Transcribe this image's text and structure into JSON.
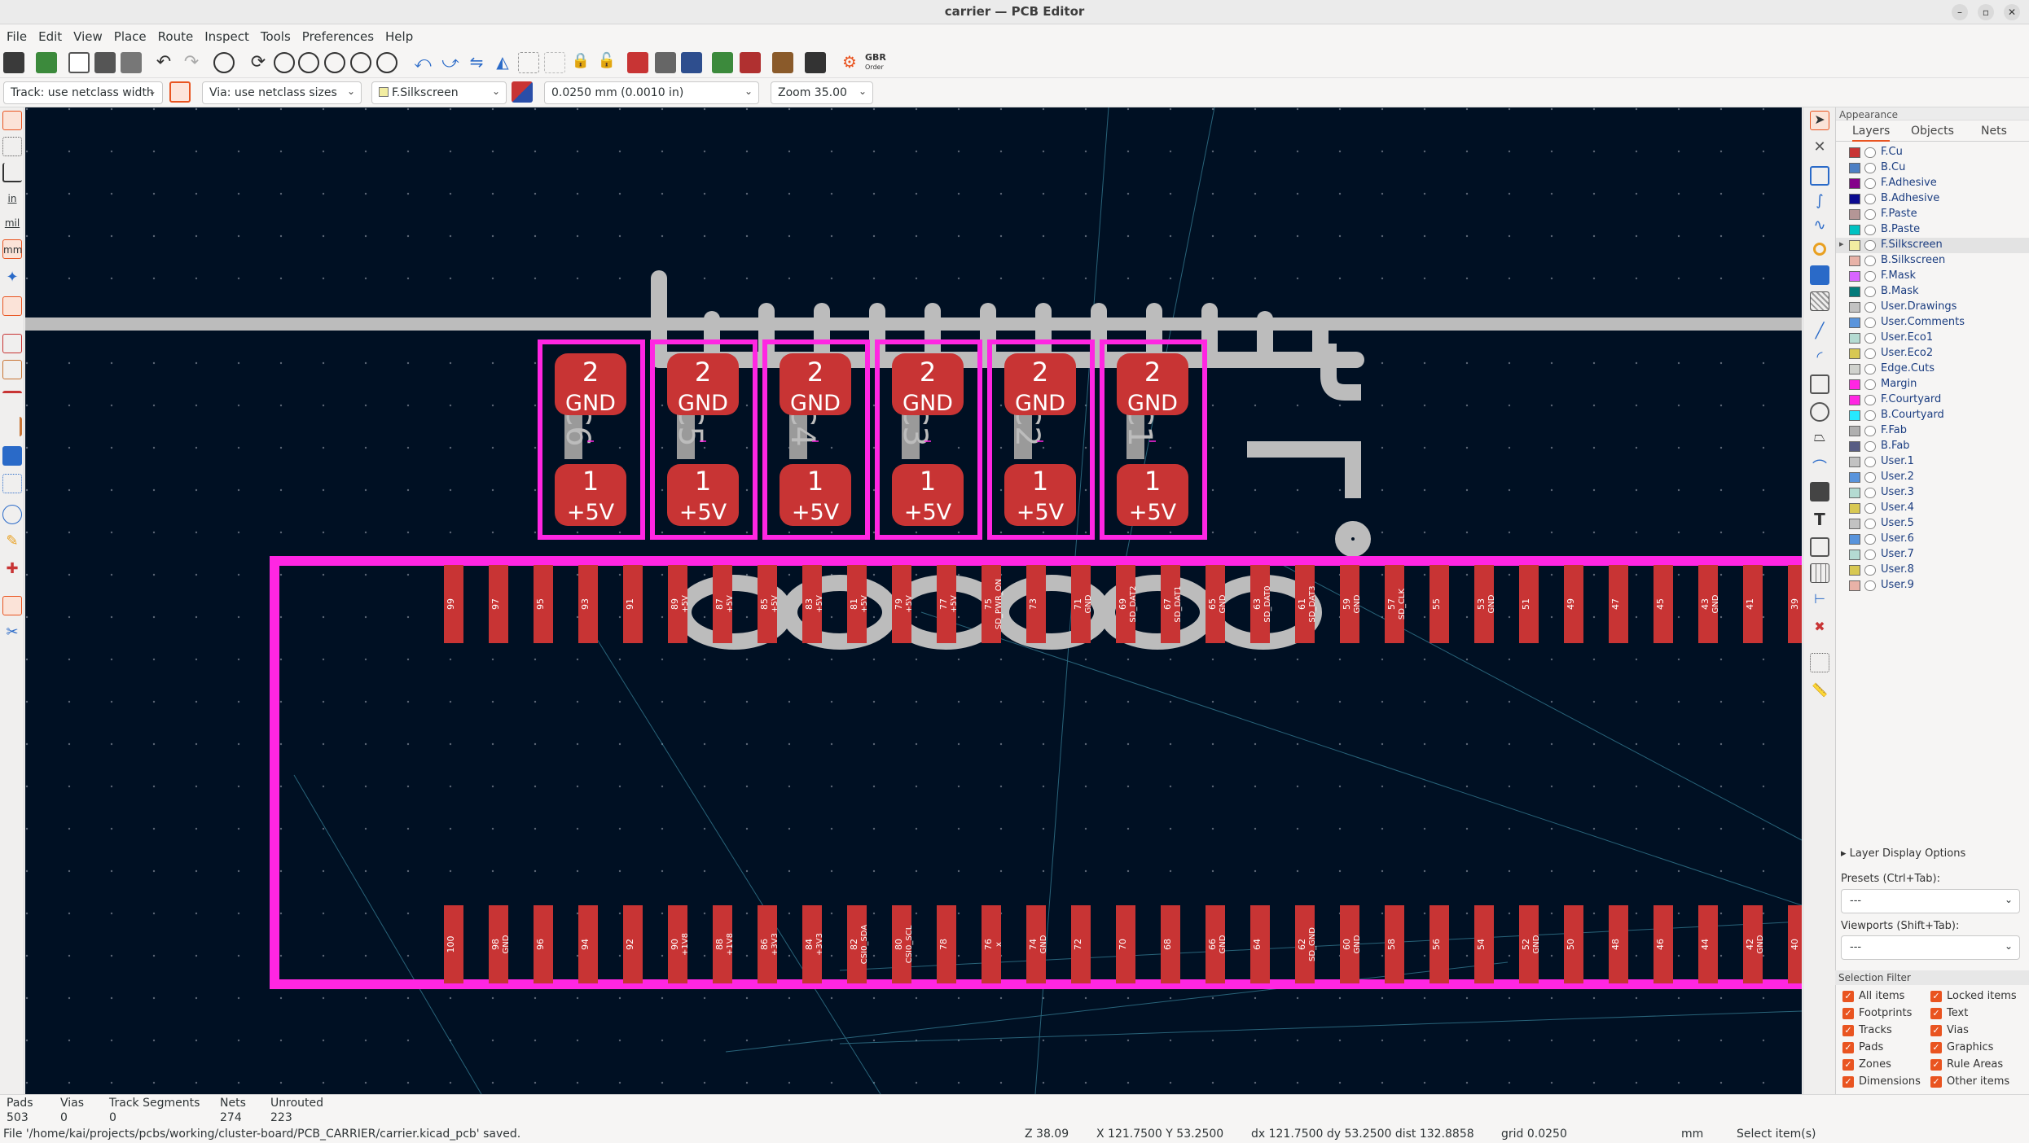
{
  "window": {
    "title": "carrier — PCB Editor"
  },
  "menu": [
    "File",
    "Edit",
    "View",
    "Place",
    "Route",
    "Inspect",
    "Tools",
    "Preferences",
    "Help"
  ],
  "toolbar2": {
    "track_width": "Track: use netclass width",
    "via_size": "Via: use netclass sizes",
    "layer": "F.Silkscreen",
    "grid": "0.0250 mm (0.0010 in)",
    "zoom": "Zoom 35.00"
  },
  "gerber_label": "GBR",
  "gerber_sub": "Order",
  "units": {
    "in": "in",
    "mil": "mil",
    "mm": "mm"
  },
  "capacitors": [
    {
      "ref": "C6",
      "pad2_num": "2",
      "pad2_net": "GND",
      "pad1_num": "1",
      "pad1_net": "+5V"
    },
    {
      "ref": "C5",
      "pad2_num": "2",
      "pad2_net": "GND",
      "pad1_num": "1",
      "pad1_net": "+5V"
    },
    {
      "ref": "C4",
      "pad2_num": "2",
      "pad2_net": "GND",
      "pad1_num": "1",
      "pad1_net": "+5V"
    },
    {
      "ref": "C3",
      "pad2_num": "2",
      "pad2_net": "GND",
      "pad1_num": "1",
      "pad1_net": "+5V"
    },
    {
      "ref": "C2",
      "pad2_num": "2",
      "pad2_net": "GND",
      "pad1_num": "1",
      "pad1_net": "+5V"
    },
    {
      "ref": "C1",
      "pad2_num": "2",
      "pad2_net": "GND",
      "pad1_num": "1",
      "pad1_net": "+5V"
    }
  ],
  "connector_top_pins": [
    {
      "num": "99",
      "net": ""
    },
    {
      "num": "97",
      "net": ""
    },
    {
      "num": "95",
      "net": ""
    },
    {
      "num": "93",
      "net": ""
    },
    {
      "num": "91",
      "net": ""
    },
    {
      "num": "89",
      "net": "+5V"
    },
    {
      "num": "87",
      "net": "+5V"
    },
    {
      "num": "85",
      "net": "+5V"
    },
    {
      "num": "83",
      "net": "+5V"
    },
    {
      "num": "81",
      "net": "+5V"
    },
    {
      "num": "79",
      "net": "+5V"
    },
    {
      "num": "77",
      "net": "+5V"
    },
    {
      "num": "75",
      "net": "SD_PWR_ON"
    },
    {
      "num": "73",
      "net": ""
    },
    {
      "num": "71",
      "net": "GND"
    },
    {
      "num": "69",
      "net": "SD_DAT2"
    },
    {
      "num": "67",
      "net": "SD_DAT1"
    },
    {
      "num": "65",
      "net": "GND"
    },
    {
      "num": "63",
      "net": "SD_DAT0"
    },
    {
      "num": "61",
      "net": "SD_DAT3"
    },
    {
      "num": "59",
      "net": "GND"
    },
    {
      "num": "57",
      "net": "SD_CLK"
    },
    {
      "num": "55",
      "net": ""
    },
    {
      "num": "53",
      "net": "GND"
    },
    {
      "num": "51",
      "net": ""
    },
    {
      "num": "49",
      "net": ""
    },
    {
      "num": "47",
      "net": ""
    },
    {
      "num": "45",
      "net": ""
    },
    {
      "num": "43",
      "net": "GND"
    },
    {
      "num": "41",
      "net": ""
    },
    {
      "num": "39",
      "net": ""
    }
  ],
  "connector_bottom_pins": [
    {
      "num": "100",
      "net": ""
    },
    {
      "num": "98",
      "net": "GND"
    },
    {
      "num": "96",
      "net": ""
    },
    {
      "num": "94",
      "net": ""
    },
    {
      "num": "92",
      "net": ""
    },
    {
      "num": "90",
      "net": "+1V8"
    },
    {
      "num": "88",
      "net": "+1V8"
    },
    {
      "num": "86",
      "net": "+3V3"
    },
    {
      "num": "84",
      "net": "+3V3"
    },
    {
      "num": "82",
      "net": "CSI0_SDA"
    },
    {
      "num": "80",
      "net": "CSI0_SCL"
    },
    {
      "num": "78",
      "net": ""
    },
    {
      "num": "76",
      "net": "x"
    },
    {
      "num": "74",
      "net": "GND"
    },
    {
      "num": "72",
      "net": ""
    },
    {
      "num": "70",
      "net": ""
    },
    {
      "num": "68",
      "net": ""
    },
    {
      "num": "66",
      "net": "GND"
    },
    {
      "num": "64",
      "net": ""
    },
    {
      "num": "62",
      "net": "SD_GND"
    },
    {
      "num": "60",
      "net": "GND"
    },
    {
      "num": "58",
      "net": ""
    },
    {
      "num": "56",
      "net": ""
    },
    {
      "num": "54",
      "net": ""
    },
    {
      "num": "52",
      "net": "GND"
    },
    {
      "num": "50",
      "net": ""
    },
    {
      "num": "48",
      "net": ""
    },
    {
      "num": "46",
      "net": ""
    },
    {
      "num": "44",
      "net": ""
    },
    {
      "num": "42",
      "net": "GND"
    },
    {
      "num": "40",
      "net": ""
    }
  ],
  "appearance": {
    "title": "Appearance",
    "tabs": [
      "Layers",
      "Objects",
      "Nets"
    ],
    "layers": [
      {
        "name": "F.Cu",
        "color": "#c83434"
      },
      {
        "name": "B.Cu",
        "color": "#4d7fc4"
      },
      {
        "name": "F.Adhesive",
        "color": "#84008a"
      },
      {
        "name": "B.Adhesive",
        "color": "#0a0a90"
      },
      {
        "name": "F.Paste",
        "color": "#b49696"
      },
      {
        "name": "B.Paste",
        "color": "#00c2c2"
      },
      {
        "name": "F.Silkscreen",
        "color": "#f2eda1"
      },
      {
        "name": "B.Silkscreen",
        "color": "#e8b2a7"
      },
      {
        "name": "F.Mask",
        "color": "#d864ff"
      },
      {
        "name": "B.Mask",
        "color": "#027a7a"
      },
      {
        "name": "User.Drawings",
        "color": "#c2c2c2"
      },
      {
        "name": "User.Comments",
        "color": "#5994dc"
      },
      {
        "name": "User.Eco1",
        "color": "#b4dbd2"
      },
      {
        "name": "User.Eco2",
        "color": "#d8c852"
      },
      {
        "name": "Edge.Cuts",
        "color": "#d0d2cd"
      },
      {
        "name": "Margin",
        "color": "#ff26e2"
      },
      {
        "name": "F.Courtyard",
        "color": "#ff26e2"
      },
      {
        "name": "B.Courtyard",
        "color": "#26e9ff"
      },
      {
        "name": "F.Fab",
        "color": "#afafaf"
      },
      {
        "name": "B.Fab",
        "color": "#585d84"
      },
      {
        "name": "User.1",
        "color": "#c2c2c2"
      },
      {
        "name": "User.2",
        "color": "#5994dc"
      },
      {
        "name": "User.3",
        "color": "#b4dbd2"
      },
      {
        "name": "User.4",
        "color": "#d8c852"
      },
      {
        "name": "User.5",
        "color": "#c2c2c2"
      },
      {
        "name": "User.6",
        "color": "#5994dc"
      },
      {
        "name": "User.7",
        "color": "#b4dbd2"
      },
      {
        "name": "User.8",
        "color": "#d8c852"
      },
      {
        "name": "User.9",
        "color": "#e8b2a7"
      }
    ],
    "active_layer": "F.Silkscreen",
    "layer_display_options": "Layer Display Options",
    "presets_label": "Presets (Ctrl+Tab):",
    "presets_value": "---",
    "viewports_label": "Viewports (Shift+Tab):",
    "viewports_value": "---"
  },
  "selection_filter": {
    "title": "Selection Filter",
    "items": [
      "All items",
      "Locked items",
      "Footprints",
      "Text",
      "Tracks",
      "Vias",
      "Pads",
      "Graphics",
      "Zones",
      "Rule Areas",
      "Dimensions",
      "Other items"
    ]
  },
  "status": {
    "stats": [
      {
        "label": "Pads",
        "value": "503"
      },
      {
        "label": "Vias",
        "value": "0"
      },
      {
        "label": "Track Segments",
        "value": "0"
      },
      {
        "label": "Nets",
        "value": "274"
      },
      {
        "label": "Unrouted",
        "value": "223"
      }
    ],
    "message": "File '/home/kai/projects/pcbs/working/cluster-board/PCB_CARRIER/carrier.kicad_pcb' saved.",
    "zoom": "Z 38.09",
    "xy": "X 121.7500  Y 53.2500",
    "delta": "dx 121.7500  dy 53.2500  dist 132.8858",
    "grid": "grid 0.0250",
    "units": "mm",
    "mode": "Select item(s)"
  },
  "colors": {
    "canvas": "#001023",
    "pad": "#c83434",
    "silk": "#bcbcbc",
    "courtyard": "#ff26e2",
    "accent": "#e95420"
  }
}
